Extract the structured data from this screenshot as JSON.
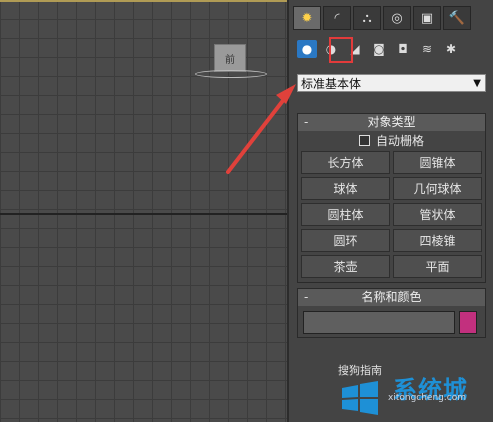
{
  "viewport": {
    "viewcube_label": "前"
  },
  "command_panel": {
    "tabs": [
      {
        "icon": "create-icon",
        "glyph": "✹"
      },
      {
        "icon": "modify-icon",
        "glyph": "◜"
      },
      {
        "icon": "hierarchy-icon",
        "glyph": "⛬"
      },
      {
        "icon": "motion-icon",
        "glyph": "◎"
      },
      {
        "icon": "display-icon",
        "glyph": "▣"
      },
      {
        "icon": "utilities-icon",
        "glyph": "🔨"
      }
    ],
    "subtabs": [
      {
        "icon": "geometry-icon",
        "glyph": "●"
      },
      {
        "icon": "shapes-icon",
        "glyph": "◑"
      },
      {
        "icon": "lights-icon",
        "glyph": "◢"
      },
      {
        "icon": "cameras-icon",
        "glyph": "◙"
      },
      {
        "icon": "helpers-icon",
        "glyph": "◘"
      },
      {
        "icon": "spacewarps-icon",
        "glyph": "≋"
      },
      {
        "icon": "systems-icon",
        "glyph": "✱"
      }
    ],
    "dropdown": {
      "selected": "标准基本体"
    },
    "object_type": {
      "header": "对象类型",
      "autogrid_label": "自动栅格",
      "buttons": [
        "长方体",
        "圆锥体",
        "球体",
        "几何球体",
        "圆柱体",
        "管状体",
        "圆环",
        "四棱锥",
        "茶壶",
        "平面"
      ]
    },
    "name_color": {
      "header": "名称和颜色",
      "swatch_color": "#c2307e"
    }
  },
  "watermark": {
    "line1": "搜狗指南",
    "brand": "系统城",
    "url": "xitongcheng.com"
  }
}
